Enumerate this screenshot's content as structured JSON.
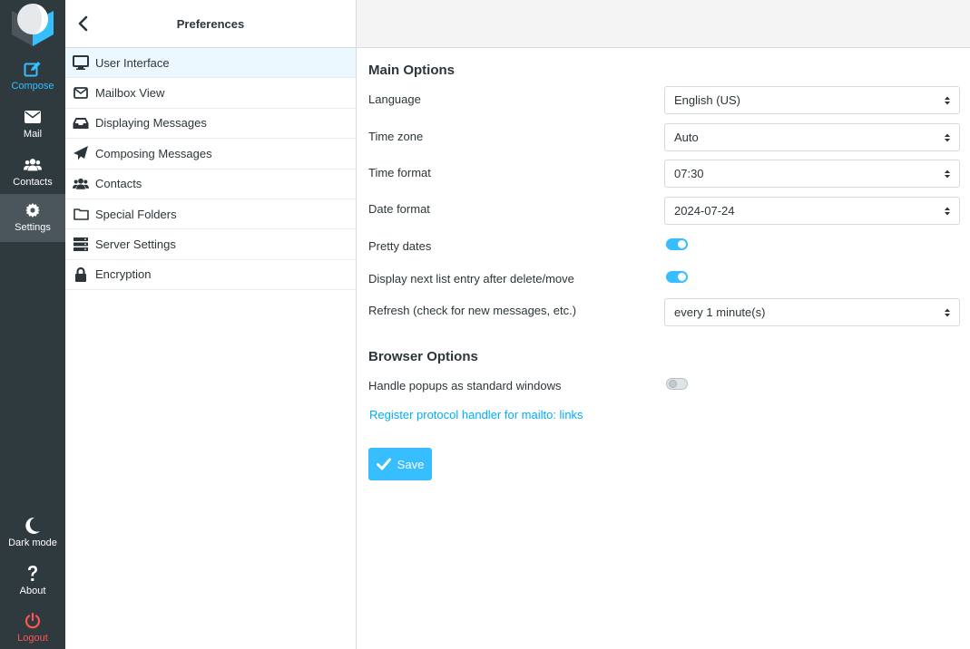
{
  "nav": {
    "compose": "Compose",
    "mail": "Mail",
    "contacts": "Contacts",
    "settings": "Settings",
    "dark_mode": "Dark mode",
    "about": "About",
    "logout": "Logout"
  },
  "prefs": {
    "title": "Preferences",
    "items": [
      {
        "label": "User Interface",
        "icon": "monitor-icon"
      },
      {
        "label": "Mailbox View",
        "icon": "envelope-icon"
      },
      {
        "label": "Displaying Messages",
        "icon": "inbox-icon"
      },
      {
        "label": "Composing Messages",
        "icon": "paper-plane-icon"
      },
      {
        "label": "Contacts",
        "icon": "users-icon"
      },
      {
        "label": "Special Folders",
        "icon": "folder-icon"
      },
      {
        "label": "Server Settings",
        "icon": "server-icon"
      },
      {
        "label": "Encryption",
        "icon": "lock-icon"
      }
    ]
  },
  "main": {
    "main_options_title": "Main Options",
    "language_label": "Language",
    "language_value": "English (US)",
    "timezone_label": "Time zone",
    "timezone_value": "Auto",
    "time_format_label": "Time format",
    "time_format_value": "07:30",
    "date_format_label": "Date format",
    "date_format_value": "2024-07-24",
    "pretty_dates_label": "Pretty dates",
    "pretty_dates_on": true,
    "next_entry_label": "Display next list entry after delete/move",
    "next_entry_on": true,
    "refresh_label": "Refresh (check for new messages, etc.)",
    "refresh_value": "every 1 minute(s)",
    "browser_options_title": "Browser Options",
    "popups_label": "Handle popups as standard windows",
    "popups_on": false,
    "mailto_link": "Register protocol handler for mailto: links",
    "save_label": "Save"
  },
  "colors": {
    "accent": "#37beff",
    "nav_bg": "#2f3a3f",
    "logout": "#ff5552"
  }
}
